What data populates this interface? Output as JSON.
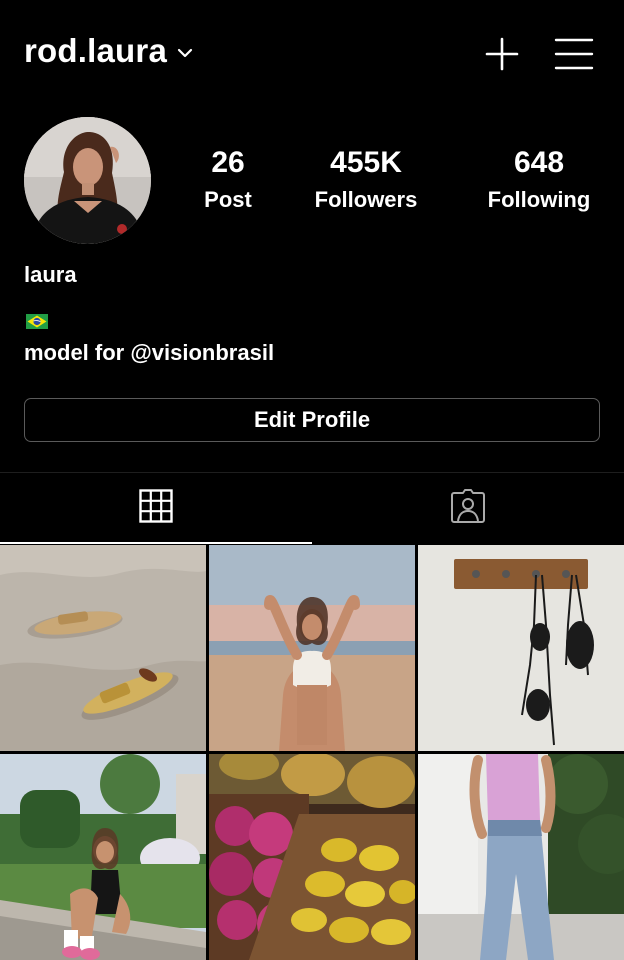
{
  "header": {
    "username": "rod.laura",
    "dropdown_icon": "chevron-down-icon",
    "add_icon": "plus-icon",
    "menu_icon": "hamburger-menu-icon"
  },
  "profile": {
    "display_name": "laura",
    "flag": "🇧🇷",
    "bio": "model for @visionbrasil",
    "edit_button_label": "Edit Profile"
  },
  "stats": [
    {
      "value": "26",
      "label": "Post"
    },
    {
      "value": "455K",
      "label": "Followers"
    },
    {
      "value": "648",
      "label": "Following"
    }
  ],
  "tabs": [
    {
      "icon": "grid-icon",
      "active": true
    },
    {
      "icon": "tagged-person-icon",
      "active": false
    }
  ],
  "posts": [
    {
      "subject": "gold sandals on sand"
    },
    {
      "subject": "woman in white top on beach"
    },
    {
      "subject": "bikini hanging on wall hooks"
    },
    {
      "subject": "woman sitting on curb by garden"
    },
    {
      "subject": "crates of dragon fruit and starfruit"
    },
    {
      "subject": "woman in pink top and jeans"
    }
  ],
  "colors": {
    "background": "#000000",
    "text": "#ffffff",
    "button_border": "#5a5a5a"
  }
}
